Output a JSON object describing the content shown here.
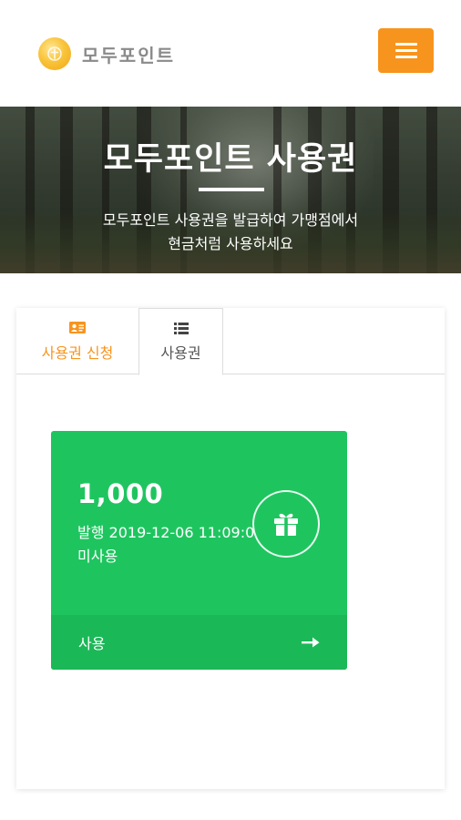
{
  "header": {
    "brand_name": "모두포인트",
    "logo_icon": "coin-logo-icon",
    "menu_icon": "hamburger-menu-icon",
    "accent_color": "#f7941d"
  },
  "hero": {
    "title": "모두포인트 사용권",
    "description_line1": "모두포인트 사용권을 발급하여 가맹점에서",
    "description_line2": "현금처럼 사용하세요"
  },
  "tabs": [
    {
      "label": "사용권 신청",
      "icon": "id-card-icon",
      "active": false
    },
    {
      "label": "사용권",
      "icon": "list-icon",
      "active": true
    }
  ],
  "voucher": {
    "amount": "1,000",
    "issued": "발행 2019-12-06 11:09:01",
    "status": "미사용",
    "gift_icon": "gift-icon",
    "use_label": "사용",
    "arrow_icon": "arrow-right-icon",
    "color": "#1ec55f"
  }
}
